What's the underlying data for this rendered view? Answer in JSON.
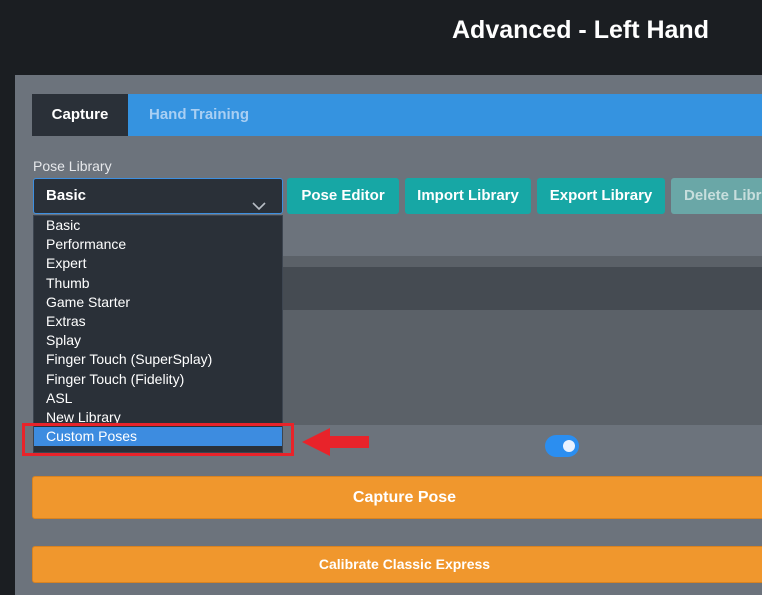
{
  "header": {
    "title": "Advanced - Left Hand"
  },
  "tabs": [
    {
      "label": "Capture",
      "active": true
    },
    {
      "label": "Hand Training",
      "active": false
    }
  ],
  "pose_library": {
    "label": "Pose Library",
    "selected": "Basic",
    "options": [
      "Basic",
      "Performance",
      "Expert",
      "Thumb",
      "Game Starter",
      "Extras",
      "Splay",
      "Finger Touch (SuperSplay)",
      "Finger Touch (Fidelity)",
      "ASL",
      "New Library",
      "Custom Poses"
    ],
    "highlighted_option": "Custom Poses"
  },
  "toolbar": {
    "pose_editor": "Pose Editor",
    "import_library": "Import Library",
    "export_library": "Export Library",
    "delete_library": "Delete Library"
  },
  "actions": {
    "capture_pose": "Capture Pose",
    "calibrate": "Calibrate Classic Express"
  },
  "toggle": {
    "on": true
  },
  "colors": {
    "background": "#1b1e22",
    "panel": "#6c737c",
    "tabbar": "#3593e0",
    "teal": "#17a7a5",
    "orange": "#f0972d",
    "annotation_red": "#e8232a",
    "selected_item": "#3d8ce0"
  }
}
